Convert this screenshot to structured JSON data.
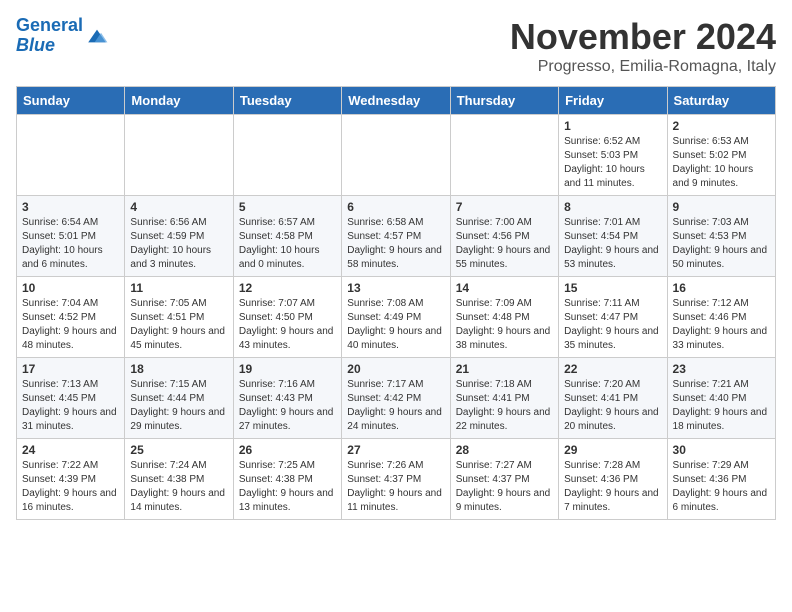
{
  "logo": {
    "line1": "General",
    "line2": "Blue"
  },
  "title": "November 2024",
  "subtitle": "Progresso, Emilia-Romagna, Italy",
  "headers": [
    "Sunday",
    "Monday",
    "Tuesday",
    "Wednesday",
    "Thursday",
    "Friday",
    "Saturday"
  ],
  "weeks": [
    [
      {
        "day": "",
        "info": ""
      },
      {
        "day": "",
        "info": ""
      },
      {
        "day": "",
        "info": ""
      },
      {
        "day": "",
        "info": ""
      },
      {
        "day": "",
        "info": ""
      },
      {
        "day": "1",
        "info": "Sunrise: 6:52 AM\nSunset: 5:03 PM\nDaylight: 10 hours and 11 minutes."
      },
      {
        "day": "2",
        "info": "Sunrise: 6:53 AM\nSunset: 5:02 PM\nDaylight: 10 hours and 9 minutes."
      }
    ],
    [
      {
        "day": "3",
        "info": "Sunrise: 6:54 AM\nSunset: 5:01 PM\nDaylight: 10 hours and 6 minutes."
      },
      {
        "day": "4",
        "info": "Sunrise: 6:56 AM\nSunset: 4:59 PM\nDaylight: 10 hours and 3 minutes."
      },
      {
        "day": "5",
        "info": "Sunrise: 6:57 AM\nSunset: 4:58 PM\nDaylight: 10 hours and 0 minutes."
      },
      {
        "day": "6",
        "info": "Sunrise: 6:58 AM\nSunset: 4:57 PM\nDaylight: 9 hours and 58 minutes."
      },
      {
        "day": "7",
        "info": "Sunrise: 7:00 AM\nSunset: 4:56 PM\nDaylight: 9 hours and 55 minutes."
      },
      {
        "day": "8",
        "info": "Sunrise: 7:01 AM\nSunset: 4:54 PM\nDaylight: 9 hours and 53 minutes."
      },
      {
        "day": "9",
        "info": "Sunrise: 7:03 AM\nSunset: 4:53 PM\nDaylight: 9 hours and 50 minutes."
      }
    ],
    [
      {
        "day": "10",
        "info": "Sunrise: 7:04 AM\nSunset: 4:52 PM\nDaylight: 9 hours and 48 minutes."
      },
      {
        "day": "11",
        "info": "Sunrise: 7:05 AM\nSunset: 4:51 PM\nDaylight: 9 hours and 45 minutes."
      },
      {
        "day": "12",
        "info": "Sunrise: 7:07 AM\nSunset: 4:50 PM\nDaylight: 9 hours and 43 minutes."
      },
      {
        "day": "13",
        "info": "Sunrise: 7:08 AM\nSunset: 4:49 PM\nDaylight: 9 hours and 40 minutes."
      },
      {
        "day": "14",
        "info": "Sunrise: 7:09 AM\nSunset: 4:48 PM\nDaylight: 9 hours and 38 minutes."
      },
      {
        "day": "15",
        "info": "Sunrise: 7:11 AM\nSunset: 4:47 PM\nDaylight: 9 hours and 35 minutes."
      },
      {
        "day": "16",
        "info": "Sunrise: 7:12 AM\nSunset: 4:46 PM\nDaylight: 9 hours and 33 minutes."
      }
    ],
    [
      {
        "day": "17",
        "info": "Sunrise: 7:13 AM\nSunset: 4:45 PM\nDaylight: 9 hours and 31 minutes."
      },
      {
        "day": "18",
        "info": "Sunrise: 7:15 AM\nSunset: 4:44 PM\nDaylight: 9 hours and 29 minutes."
      },
      {
        "day": "19",
        "info": "Sunrise: 7:16 AM\nSunset: 4:43 PM\nDaylight: 9 hours and 27 minutes."
      },
      {
        "day": "20",
        "info": "Sunrise: 7:17 AM\nSunset: 4:42 PM\nDaylight: 9 hours and 24 minutes."
      },
      {
        "day": "21",
        "info": "Sunrise: 7:18 AM\nSunset: 4:41 PM\nDaylight: 9 hours and 22 minutes."
      },
      {
        "day": "22",
        "info": "Sunrise: 7:20 AM\nSunset: 4:41 PM\nDaylight: 9 hours and 20 minutes."
      },
      {
        "day": "23",
        "info": "Sunrise: 7:21 AM\nSunset: 4:40 PM\nDaylight: 9 hours and 18 minutes."
      }
    ],
    [
      {
        "day": "24",
        "info": "Sunrise: 7:22 AM\nSunset: 4:39 PM\nDaylight: 9 hours and 16 minutes."
      },
      {
        "day": "25",
        "info": "Sunrise: 7:24 AM\nSunset: 4:38 PM\nDaylight: 9 hours and 14 minutes."
      },
      {
        "day": "26",
        "info": "Sunrise: 7:25 AM\nSunset: 4:38 PM\nDaylight: 9 hours and 13 minutes."
      },
      {
        "day": "27",
        "info": "Sunrise: 7:26 AM\nSunset: 4:37 PM\nDaylight: 9 hours and 11 minutes."
      },
      {
        "day": "28",
        "info": "Sunrise: 7:27 AM\nSunset: 4:37 PM\nDaylight: 9 hours and 9 minutes."
      },
      {
        "day": "29",
        "info": "Sunrise: 7:28 AM\nSunset: 4:36 PM\nDaylight: 9 hours and 7 minutes."
      },
      {
        "day": "30",
        "info": "Sunrise: 7:29 AM\nSunset: 4:36 PM\nDaylight: 9 hours and 6 minutes."
      }
    ]
  ]
}
